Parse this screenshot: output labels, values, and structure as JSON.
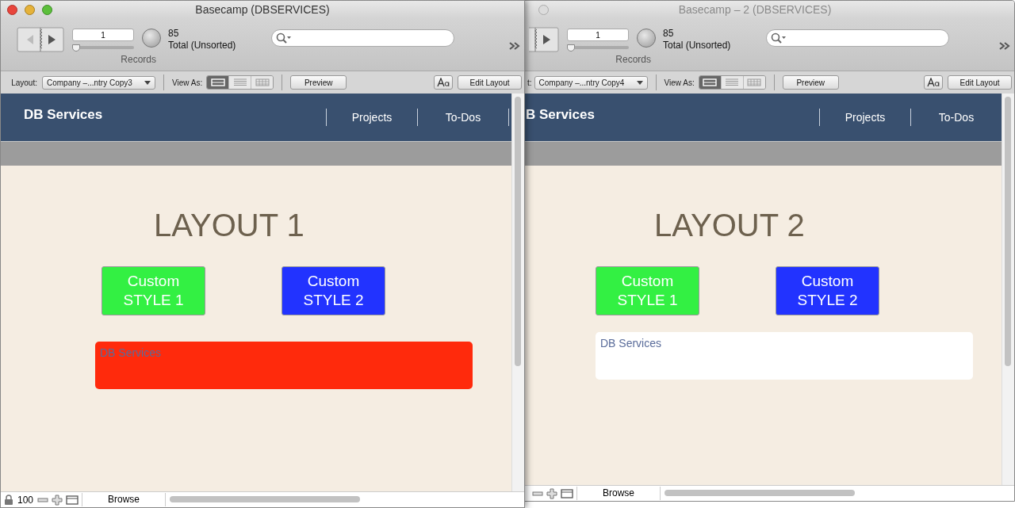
{
  "windows": [
    {
      "active": true,
      "title": "Basecamp (DBSERVICES)",
      "toolbar": {
        "record": "1",
        "level": 0,
        "found": "85",
        "total": "Total (Unsorted)",
        "records_label": "Records"
      },
      "layout_bar": {
        "layout_label": "Layout:",
        "layout": "Company –...ntry Copy3",
        "view_as_label": "View As:",
        "view_modes": [
          {
            "kind": "form",
            "selected": true
          },
          {
            "kind": "list",
            "selected": false
          },
          {
            "kind": "table",
            "selected": false
          }
        ],
        "preview": "Preview",
        "edit_layout": "Edit Layout"
      },
      "header": {
        "brand": "DB Services",
        "nav": [
          "Projects",
          "To-Dos"
        ],
        "nav_overflow": true
      },
      "heading": "LAYOUT 1",
      "buttons": [
        {
          "lines": [
            "Custom",
            "STYLE 1"
          ],
          "color": "#33f043"
        },
        {
          "lines": [
            "Custom",
            "STYLE 2"
          ],
          "color": "#2233ff"
        }
      ],
      "field": {
        "value": "DB Services",
        "color": "#ff2a0c"
      },
      "status": {
        "zoom": "100",
        "mode": "Browse"
      }
    },
    {
      "active": false,
      "title": "Basecamp – 2 (DBSERVICES)",
      "toolbar": {
        "record": "1",
        "level": 0,
        "found": "85",
        "total": "Total (Unsorted)",
        "records_label": "Records"
      },
      "layout_bar": {
        "layout_label": "t:",
        "layout": "Company –...ntry Copy4",
        "view_as_label": "View As:",
        "view_modes": [
          {
            "kind": "form",
            "selected": true
          },
          {
            "kind": "list",
            "selected": false
          },
          {
            "kind": "table",
            "selected": false
          }
        ],
        "preview": "Preview",
        "edit_layout": "Edit Layout"
      },
      "header": {
        "brand": "B Services",
        "nav": [
          "Projects",
          "To-Dos"
        ],
        "nav_overflow": false
      },
      "heading": "LAYOUT 2",
      "buttons": [
        {
          "lines": [
            "Custom",
            "STYLE 1"
          ],
          "color": "#33f043"
        },
        {
          "lines": [
            "Custom",
            "STYLE 2"
          ],
          "color": "#2233ff"
        }
      ],
      "field": {
        "value": "DB Services",
        "color": "#ffffff"
      },
      "status": {
        "mode": "Browse"
      }
    }
  ]
}
